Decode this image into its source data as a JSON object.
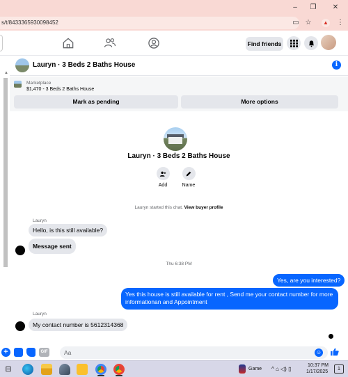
{
  "browser": {
    "url_fragment": "s/t/8433365930098452",
    "window_buttons": {
      "minimize": "–",
      "maximize": "❐",
      "close": "✕"
    },
    "profile_letter": "▲"
  },
  "fb_nav": {
    "find_friends_label": "Find friends"
  },
  "chat": {
    "header_title": "Lauryn · 3 Beds 2 Baths House",
    "info_glyph": "i",
    "marketplace": {
      "label": "Marketplace",
      "listing": "$1,470 - 3 Beds 2 Baths House"
    },
    "buttons": {
      "mark_pending": "Mark as pending",
      "more_options": "More options"
    },
    "intro": {
      "title": "Lauryn · 3 Beds 2 Baths House",
      "actions": [
        {
          "label": "Add"
        },
        {
          "label": "Name"
        }
      ],
      "started_text": "Lauryn started this chat.",
      "started_link": "View buyer profile"
    },
    "messages": [
      {
        "sender": "Lauryn",
        "text": "Hello, is this still available?",
        "direction": "in"
      },
      {
        "text": "Message sent",
        "direction": "in"
      },
      {
        "timestamp": "Thu 6:38 PM"
      },
      {
        "text": "Yes, are you interested?",
        "direction": "out"
      },
      {
        "text": "Yes this house is still available for rent , Send me your contact number for more informationan and Appointment",
        "direction": "out"
      },
      {
        "sender": "Lauryn",
        "text": "My contact number is 5612314368",
        "direction": "in"
      }
    ],
    "composer": {
      "placeholder": "Aa"
    }
  },
  "taskbar": {
    "game_label": "Game",
    "time": "10:37 PM",
    "date": "1/17/2025",
    "tray_icons": "^ ⌂ ◁) ▯",
    "notification_count": "1"
  },
  "colors": {
    "accent": "#0866ff",
    "titlebar": "#f9d9d4",
    "bubble_in": "#e4e6eb",
    "taskbar": "#d7d7e8"
  }
}
